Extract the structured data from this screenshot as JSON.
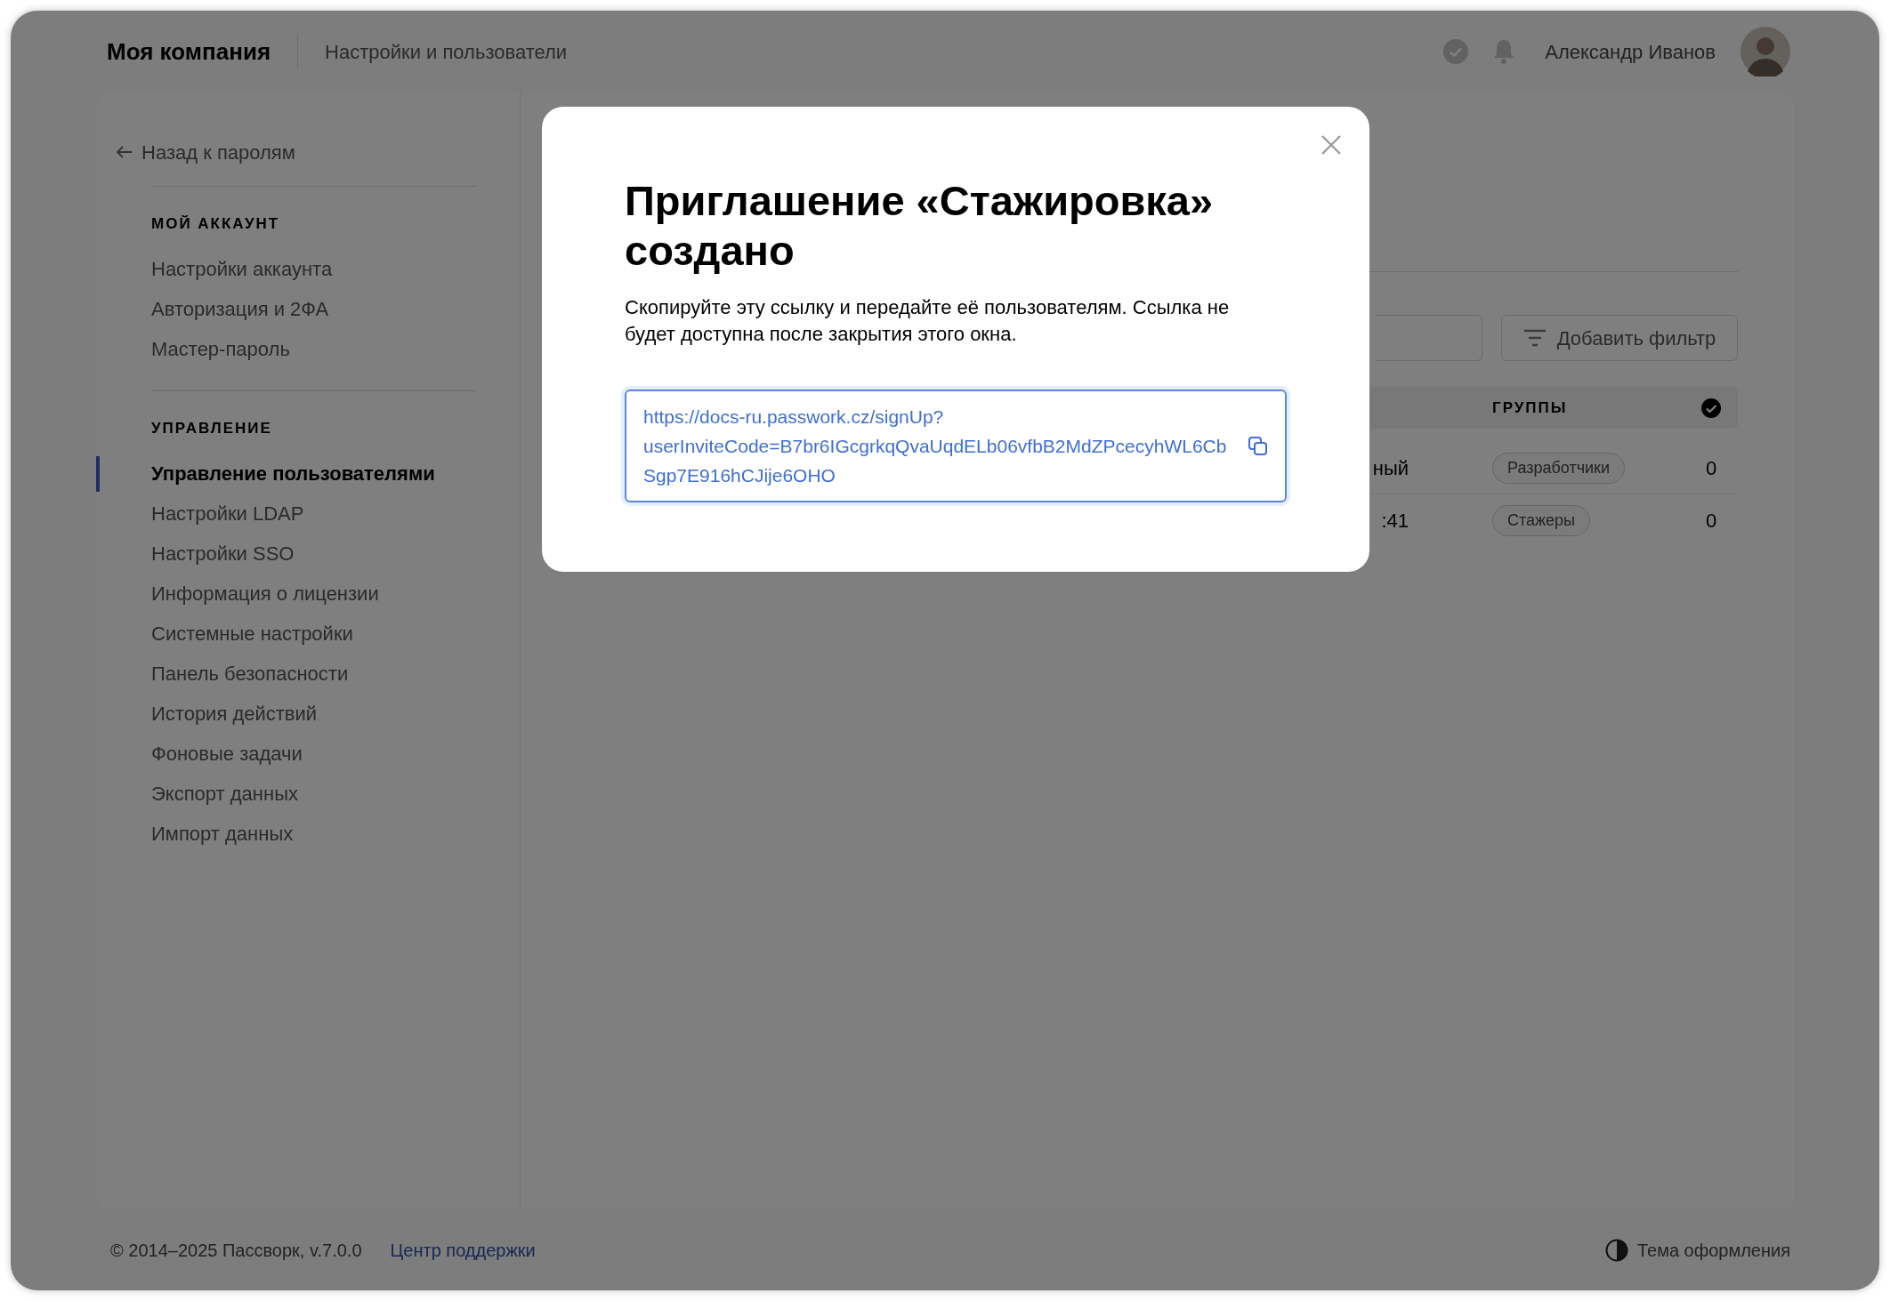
{
  "header": {
    "company": "Моя компания",
    "section": "Настройки и пользователи",
    "user_name": "Александр Иванов"
  },
  "sidebar": {
    "back_link": "Назад к паролям",
    "sections": [
      {
        "heading": "МОЙ АККАУНТ",
        "items": [
          {
            "label": "Настройки аккаунта",
            "selected": false
          },
          {
            "label": "Авторизация и 2ФА",
            "selected": false
          },
          {
            "label": "Мастер-пароль",
            "selected": false
          }
        ]
      },
      {
        "heading": "УПРАВЛЕНИЕ",
        "items": [
          {
            "label": "Управление пользователями",
            "selected": true
          },
          {
            "label": "Настройки LDAP",
            "selected": false
          },
          {
            "label": "Настройки SSO",
            "selected": false
          },
          {
            "label": "Информация о лицензии",
            "selected": false
          },
          {
            "label": "Системные настройки",
            "selected": false
          },
          {
            "label": "Панель безопасности",
            "selected": false
          },
          {
            "label": "История действий",
            "selected": false
          },
          {
            "label": "Фоновые задачи",
            "selected": false
          },
          {
            "label": "Экспорт данных",
            "selected": false
          },
          {
            "label": "Импорт данных",
            "selected": false
          }
        ]
      }
    ]
  },
  "toolbar": {
    "filter_button": "Добавить фильтр"
  },
  "table": {
    "columns": [
      "ГРУППЫ"
    ],
    "select_all_checked": true,
    "rows": [
      {
        "column_1": "ный",
        "group": "Разработчики",
        "count": "0"
      },
      {
        "column_1": ":41",
        "group": "Стажеры",
        "count": "0"
      }
    ]
  },
  "dialog": {
    "title": "Приглашение «Стажировка» создано",
    "message": "Скопируйте эту ссылку и передайте её пользователям. Ссылка не будет доступна после закрытия этого окна.",
    "invite_link": "https://docs-ru.passwork.cz/signUp?userInviteCode=B7br6IGcgrkqQvaUqdELb06vfbB2MdZPcecyhWL6CbSgp7E916hCJije6OHO"
  },
  "footer": {
    "copyright": "© 2014–2025 Пассворк, v.7.0.0",
    "support_link": "Центр поддержки",
    "theme_button": "Тема оформления"
  }
}
